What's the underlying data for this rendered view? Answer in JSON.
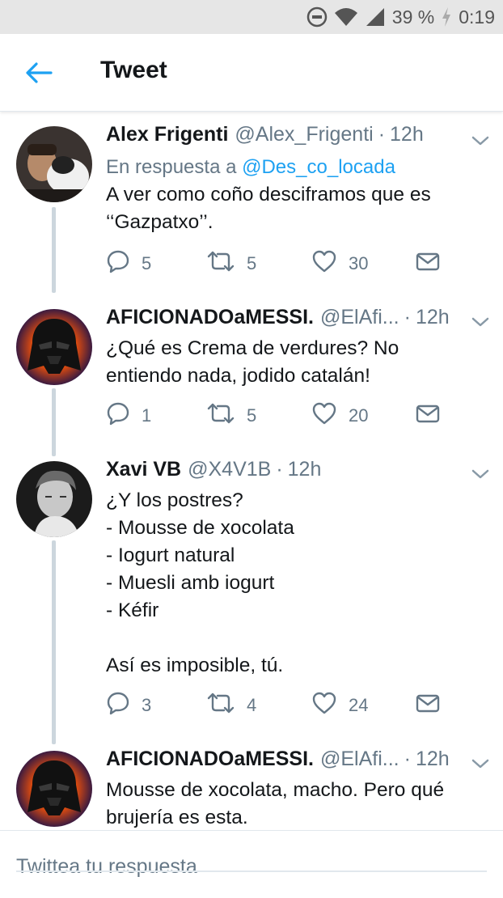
{
  "status_bar": {
    "battery": "39 %",
    "time": "0:19",
    "icons": [
      "do-not-disturb-icon",
      "wifi-icon",
      "signal-icon",
      "charging-icon"
    ]
  },
  "header": {
    "title": "Tweet",
    "back_icon": "back-arrow-icon",
    "accent": "#1da1f2"
  },
  "tweets": [
    {
      "name": "Alex Frigenti",
      "handle": "@Alex_Frigenti",
      "separator": "·",
      "time": "12h",
      "reply_prefix": "En respuesta a",
      "reply_mention": "@Des_co_locada",
      "text": "A ver como coño desciframos que es\n‘‘Gazpatxo’’.",
      "replies": "5",
      "retweets": "5",
      "likes": "30"
    },
    {
      "name": "AFICIONADOaMESSI.",
      "handle": "@ElAfi...",
      "separator": "·",
      "time": "12h",
      "text": "¿Qué es Crema de verdures? No\nentiendo nada, jodido catalán!",
      "replies": "1",
      "retweets": "5",
      "likes": "20"
    },
    {
      "name": "Xavi VB",
      "handle": "@X4V1B",
      "separator": "·",
      "time": "12h",
      "text": "¿Y los postres?\n- Mousse de xocolata\n- Iogurt natural\n- Muesli amb iogurt\n- Kéfir\n\nAsí es imposible, tú.",
      "replies": "3",
      "retweets": "4",
      "likes": "24"
    },
    {
      "name": "AFICIONADOaMESSI.",
      "handle": "@ElAfi...",
      "separator": "·",
      "time": "12h",
      "text": "Mousse de xocolata, macho. Pero qué\nbrujería es esta."
    }
  ],
  "composer": {
    "placeholder": "Twittea tu respuesta"
  },
  "colors": {
    "secondary_text": "#657786",
    "thread_line": "#ccd6dd",
    "status_bar_bg": "#e6e6e6"
  }
}
